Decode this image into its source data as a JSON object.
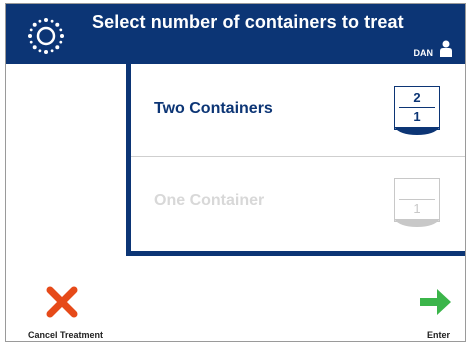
{
  "header": {
    "title": "Select number of containers to treat",
    "user": "DAN",
    "logo_icon": "sun-dots-icon",
    "user_icon": "person-icon",
    "background": "#0c3575"
  },
  "options": [
    {
      "label": "Two Containers",
      "top": "2",
      "bottom": "1",
      "state": "enabled"
    },
    {
      "label": "One Container",
      "top": "",
      "bottom": "1",
      "state": "disabled"
    }
  ],
  "actions": {
    "cancel_label": "Cancel Treatment",
    "cancel_icon": "red-x-icon",
    "enter_label": "Enter",
    "enter_icon": "green-arrow-right-icon"
  },
  "colors": {
    "accent": "#0c3575",
    "cancel": "#e64a19",
    "enter": "#3bb54a",
    "disabled": "#c8c8c8"
  }
}
